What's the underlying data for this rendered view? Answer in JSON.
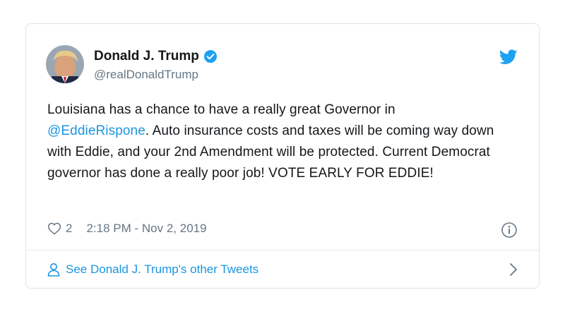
{
  "author": {
    "display_name": "Donald J. Trump",
    "handle": "@realDonaldTrump"
  },
  "tweet": {
    "text_part1": "Louisiana has a chance to have a really great Governor in",
    "mention": "@EddieRispone",
    "text_part2": ". Auto insurance costs and taxes will be coming way down with Eddie, and your 2nd Amendment will be protected. Current Democrat governor has done a really poor job! VOTE EARLY FOR EDDIE!",
    "like_count": "2",
    "timestamp": "2:18 PM - Nov 2, 2019"
  },
  "footer": {
    "link_label": "See Donald J. Trump's other Tweets"
  },
  "colors": {
    "accent": "#1b95e0",
    "secondary_text": "#657786",
    "twitter_blue": "#1da1f2"
  },
  "icons": [
    "avatar",
    "verified-badge-icon",
    "twitter-bird-icon",
    "heart-icon",
    "info-icon",
    "person-icon",
    "chevron-right-icon"
  ]
}
